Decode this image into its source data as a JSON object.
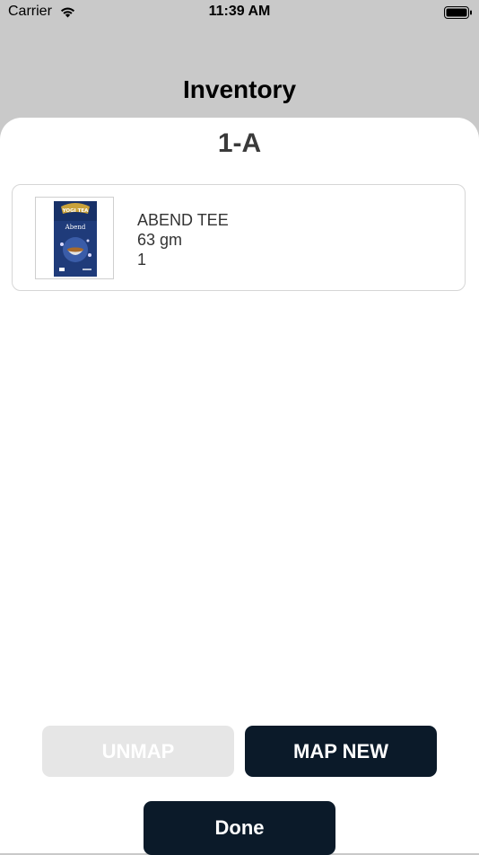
{
  "status_bar": {
    "carrier": "Carrier",
    "time": "11:39 AM",
    "wifi_icon": "wifi-icon",
    "battery_icon": "battery-full-icon"
  },
  "nav": {
    "title": "Inventory"
  },
  "sheet": {
    "title": "1-A",
    "items": [
      {
        "image": "product-thumbnail",
        "name": "ABEND TEE",
        "weight": "63 gm",
        "quantity": "1",
        "brand_text": "YOGI TEA",
        "product_text": "Abend"
      }
    ]
  },
  "actions": {
    "unmap_label": "UNMAP",
    "map_new_label": "MAP NEW",
    "done_label": "Done"
  },
  "colors": {
    "background_overlay": "#c9c9c9",
    "sheet": "#ffffff",
    "primary_button": "#0b1a29",
    "disabled_button": "#e6e6e6",
    "card_border": "#d6d6d6"
  }
}
